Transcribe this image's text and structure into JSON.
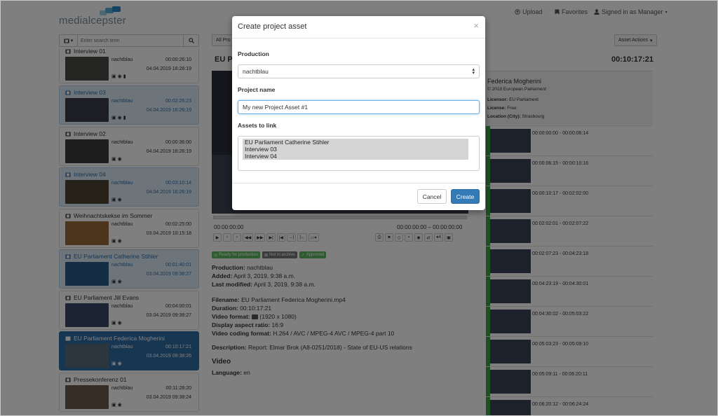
{
  "app": {
    "logo_left": "media",
    "logo_right": "lcepster"
  },
  "topnav": {
    "upload": "Upload",
    "favorites": "Favorites",
    "signed_in": "Signed in as Manager"
  },
  "search": {
    "placeholder": "Enter search term"
  },
  "toolbar": {
    "filter_partial": "All Pro",
    "asset_actions": "Asset Actions"
  },
  "assets": [
    {
      "title": "Interview 01",
      "owner": "nachtblau",
      "duration": "00:00:26:10",
      "date": "04.04.2019 16:26:19",
      "state": "normal"
    },
    {
      "title": "Interview 03",
      "owner": "nachtblau",
      "duration": "00:02:25:23",
      "date": "04.04.2019 16:26:19",
      "state": "selected"
    },
    {
      "title": "Interview 02",
      "owner": "nachtblau",
      "duration": "00:00:36:00",
      "date": "04.04.2019 16:26:19",
      "state": "normal"
    },
    {
      "title": "Interview 04",
      "owner": "nachtblau",
      "duration": "00:03:10:14",
      "date": "04.04.2019 16:26:19",
      "state": "selected"
    },
    {
      "title": "Weihnachtskekse im Sommer",
      "owner": "nachtblau",
      "duration": "00:02:25:00",
      "date": "03.04.2019 10:15:18",
      "state": "normal"
    },
    {
      "title": "EU Parliament Catherine Stihler",
      "owner": "nachtblau",
      "duration": "00:01:40:01",
      "date": "03.04.2019 09:38:27",
      "state": "selected"
    },
    {
      "title": "EU Parliament Jill Evans",
      "owner": "nachtblau",
      "duration": "00:04:00:01",
      "date": "03.04.2019 09:38:27",
      "state": "normal"
    },
    {
      "title": "EU Parliament Federica Mogherini",
      "owner": "nachtblau",
      "duration": "00:10:17:21",
      "date": "03.04.2019 09:38:26",
      "state": "active"
    },
    {
      "title": "Pressekonferenz 01",
      "owner": "nachtblau",
      "duration": "00:11:28:20",
      "date": "03.04.2019 09:38:24",
      "state": "normal"
    }
  ],
  "detail": {
    "title_partial": "EU P",
    "total_duration": "00:10:17:21",
    "time_current": "00:00:00:00",
    "time_range": "00:00:00:00 – 00:00:00:00",
    "people_count": "4",
    "status_labels": [
      "Ready for production",
      "Not in archive",
      "Approved"
    ],
    "production_label": "Production:",
    "production": "nachtblau",
    "added_label": "Added:",
    "added": "April 3, 2019, 9:38 a.m.",
    "modified_label": "Last modified:",
    "modified": "April 3, 2019, 9:38 a.m.",
    "filename_label": "Filename:",
    "filename": "EU Parliament Federica Mogherini.mp4",
    "duration_label": "Duration:",
    "duration": "00:10:17:21",
    "vformat_label": "Video format:",
    "vformat": "(1920 x 1080)",
    "aspect_label": "Display aspect ratio:",
    "aspect": "16:9",
    "coding_label": "Video coding format:",
    "coding": "H.264 / AVC / MPEG-4 AVC / MPEG-4 part 10",
    "description_label": "Description:",
    "description": "Report: Elmar Brok (A8-0251/2018) - State of EU-US relations",
    "video_heading": "Video",
    "language_label": "Language:",
    "language": "en"
  },
  "info_panel": {
    "name": "Federica Mogherini",
    "copyright": "© 2018 European Parliament",
    "licensor_label": "Licensor:",
    "licensor": "EU Parliament",
    "license_label": "License:",
    "license": "Free",
    "location_label": "Location (City):",
    "location": "Strasbourg"
  },
  "segments": [
    "00:00:00:00 - 00:00:06:14",
    "00:00:06:15 - 00:00:10:16",
    "00:00:10:17 - 00:02:02:00",
    "00:02:02:01 - 00:02:07:22",
    "00:02:07:23 - 00:04:23:18",
    "00:04:23:19 - 00:04:30:01",
    "00:04:30:02 - 00:05:03:22",
    "00:05:03:23 - 00:05:09:10",
    "00:05:09:11 - 00:06:20:11",
    "00:06:20:12 - 00:06:24:24"
  ],
  "modal": {
    "title": "Create project asset",
    "close": "×",
    "production_label": "Production",
    "production_value": "nachtblau",
    "project_name_label": "Project name",
    "project_name_value": "My new Project Asset #1",
    "assets_label": "Assets to link",
    "assets": [
      "EU Parliament Catherine Stihler",
      "Interview 03",
      "Interview 04"
    ],
    "cancel": "Cancel",
    "create": "Create"
  },
  "colors": {
    "accent": "#337ab7",
    "active_item": "#2e6da4",
    "selected_item": "#dbe8f5",
    "status_green": "#5cb85c",
    "status_gray": "#777777",
    "segment_bar": "#3aa142"
  }
}
